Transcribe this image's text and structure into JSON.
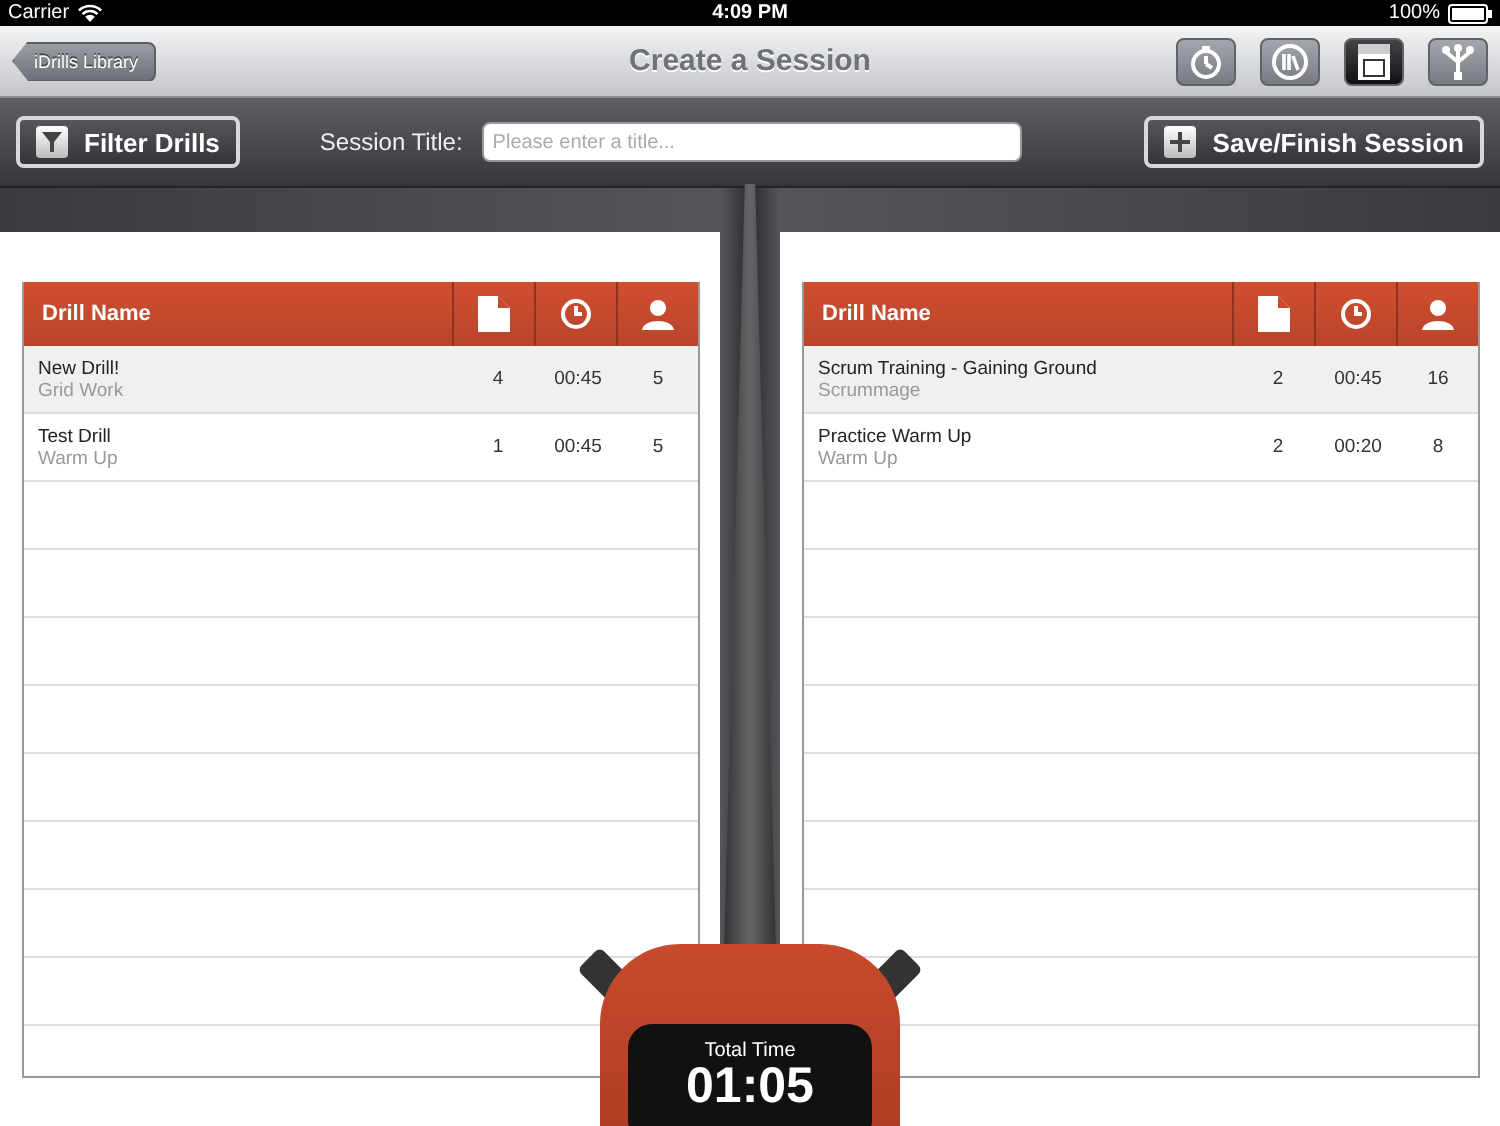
{
  "status_bar": {
    "carrier": "Carrier",
    "time": "4:09 PM",
    "battery": "100%"
  },
  "nav_bar": {
    "back_button": "iDrills Library",
    "title": "Create a Session"
  },
  "toolbar": {
    "filter_button": "Filter Drills",
    "session_title_label": "Session Title:",
    "session_title_placeholder": "Please enter a title...",
    "save_button": "Save/Finish Session"
  },
  "tables": [
    {
      "column_1": "Drill Name",
      "rows": [
        {
          "name": "New Drill!",
          "category": "Grid Work",
          "pages": "4",
          "duration": "00:45",
          "players": "5"
        },
        {
          "name": "Test Drill",
          "category": "Warm Up",
          "pages": "1",
          "duration": "00:45",
          "players": "5"
        }
      ]
    },
    {
      "column_1": "Drill Name",
      "rows": [
        {
          "name": "Scrum Training - Gaining Ground",
          "category": "Scrummage",
          "pages": "2",
          "duration": "00:45",
          "players": "16"
        },
        {
          "name": "Practice Warm Up",
          "category": "Warm Up",
          "pages": "2",
          "duration": "00:20",
          "players": "8"
        }
      ]
    }
  ],
  "stopwatch": {
    "label": "Total Time",
    "time": "01:05"
  }
}
